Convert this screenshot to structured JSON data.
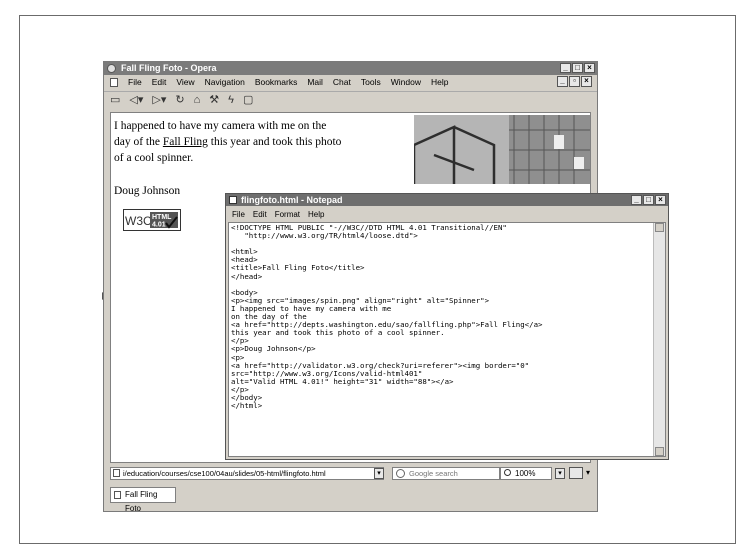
{
  "opera": {
    "title": "Fall Fling Foto - Opera",
    "menu": [
      "File",
      "Edit",
      "View",
      "Navigation",
      "Bookmarks",
      "Mail",
      "Chat",
      "Tools",
      "Window",
      "Help"
    ],
    "toolbar_icons": [
      "open-icon",
      "back-icon",
      "forward-icon",
      "reload-icon",
      "home-icon",
      "wand-icon",
      "tools-icon",
      "bookmark-icon"
    ],
    "address": "i/education/courses/cse100/04au/slides/05-html/flingfoto.html",
    "search_placeholder": "Google search",
    "zoom": "100%",
    "tab_label": "Fall Fling Foto"
  },
  "page": {
    "para_before": "I happened to have my camera with me on the day of the ",
    "link_text": "Fall Fling",
    "para_after": " this year and took this photo of a cool spinner.",
    "author": "Doug Johnson",
    "w3c_badge": {
      "w3c": "W3C",
      "html": "HTML",
      "version": "4.01"
    }
  },
  "notepad": {
    "title": "flingfoto.html - Notepad",
    "menu": [
      "File",
      "Edit",
      "Format",
      "Help"
    ],
    "source": "<!DOCTYPE HTML PUBLIC \"-//W3C//DTD HTML 4.01 Transitional//EN\"\n   \"http://www.w3.org/TR/html4/loose.dtd\">\n\n<html>\n<head>\n<title>Fall Fling Foto</title>\n</head>\n\n<body>\n<p><img src=\"images/spin.png\" align=\"right\" alt=\"Spinner\">\nI happened to have my camera with me\non the day of the\n<a href=\"http://depts.washington.edu/sao/fallfling.php\">Fall Fling</a>\nthis year and took this photo of a cool spinner.\n</p>\n<p>Doug Johnson</p>\n<p>\n<a href=\"http://validator.w3.org/check?uri=referer\"><img border=\"0\"\nsrc=\"http://www.w3.org/Icons/valid-html401\"\nalt=\"Valid HTML 4.01!\" height=\"31\" width=\"88\"></a>\n</p>\n</body>\n</html>"
  }
}
